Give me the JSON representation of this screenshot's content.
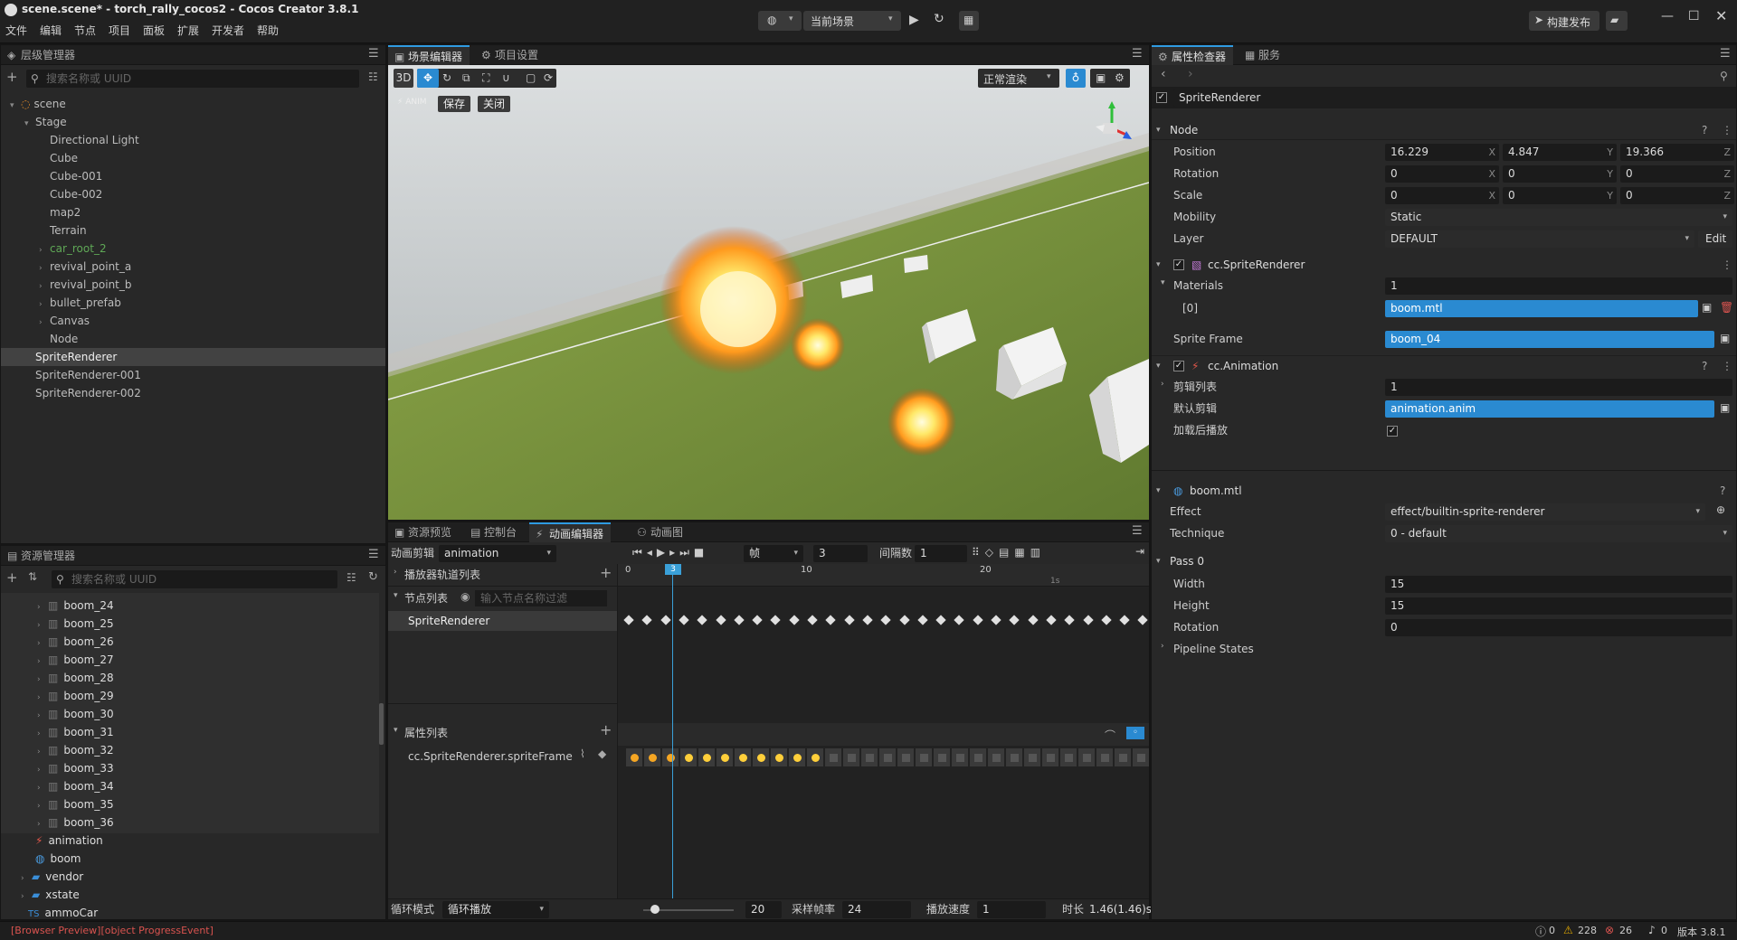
{
  "window": {
    "title": "scene.scene* - torch_rally_cocos2 - Cocos Creator 3.8.1"
  },
  "menu": [
    "文件",
    "编辑",
    "节点",
    "项目",
    "面板",
    "扩展",
    "开发者",
    "帮助"
  ],
  "toolbar": {
    "scene_select": "当前场景",
    "build_publish": "构建发布"
  },
  "hierarchy": {
    "tab": "层级管理器",
    "search_placeholder": "搜索名称或 UUID",
    "items": [
      {
        "label": "scene",
        "indent": 0,
        "arrow": "▾",
        "color": "#bcbcbc"
      },
      {
        "label": "Stage",
        "indent": 1,
        "arrow": "▾",
        "color": "#bcbcbc"
      },
      {
        "label": "Directional Light",
        "indent": 2,
        "arrow": "",
        "color": "#bcbcbc"
      },
      {
        "label": "Cube",
        "indent": 2,
        "arrow": "",
        "color": "#bcbcbc"
      },
      {
        "label": "Cube-001",
        "indent": 2,
        "arrow": "",
        "color": "#bcbcbc"
      },
      {
        "label": "Cube-002",
        "indent": 2,
        "arrow": "",
        "color": "#bcbcbc"
      },
      {
        "label": "map2",
        "indent": 2,
        "arrow": "",
        "color": "#bcbcbc"
      },
      {
        "label": "Terrain",
        "indent": 2,
        "arrow": "",
        "color": "#bcbcbc"
      },
      {
        "label": "car_root_2",
        "indent": 2,
        "arrow": "›",
        "color": "#5fa856"
      },
      {
        "label": "revival_point_a",
        "indent": 2,
        "arrow": "›",
        "color": "#bcbcbc"
      },
      {
        "label": "revival_point_b",
        "indent": 2,
        "arrow": "›",
        "color": "#bcbcbc"
      },
      {
        "label": "bullet_prefab",
        "indent": 2,
        "arrow": "›",
        "color": "#bcbcbc"
      },
      {
        "label": "Canvas",
        "indent": 2,
        "arrow": "›",
        "color": "#bcbcbc"
      },
      {
        "label": "Node",
        "indent": 2,
        "arrow": "",
        "color": "#bcbcbc"
      },
      {
        "label": "SpriteRenderer",
        "indent": 1,
        "arrow": "",
        "color": "#eeeeee",
        "selected": true
      },
      {
        "label": "SpriteRenderer-001",
        "indent": 1,
        "arrow": "",
        "color": "#bcbcbc"
      },
      {
        "label": "SpriteRenderer-002",
        "indent": 1,
        "arrow": "",
        "color": "#bcbcbc"
      }
    ]
  },
  "assets": {
    "tab": "资源管理器",
    "search_placeholder": "搜索名称或 UUID",
    "items": [
      "boom_24",
      "boom_25",
      "boom_26",
      "boom_27",
      "boom_28",
      "boom_29",
      "boom_30",
      "boom_31",
      "boom_32",
      "boom_33",
      "boom_34",
      "boom_35",
      "boom_36"
    ],
    "extra": [
      {
        "label": "animation",
        "icon": "anim"
      },
      {
        "label": "boom",
        "icon": "mtl"
      },
      {
        "label": "vendor",
        "icon": "folder"
      },
      {
        "label": "xstate",
        "icon": "folder"
      },
      {
        "label": "ammoCar",
        "icon": "ts"
      }
    ]
  },
  "scene": {
    "tabs": [
      "场景编辑器",
      "项目设置"
    ],
    "mode_3d": "3D",
    "render_mode": "正常渲染",
    "anim_label": "ANIM",
    "save": "保存",
    "close": "关闭"
  },
  "anim": {
    "tabs": [
      "资源预览",
      "控制台",
      "动画编辑器",
      "动画图"
    ],
    "clip_label": "动画剪辑",
    "clip_value": "animation",
    "unit": "帧",
    "frame": "3",
    "interval_label": "间隔数",
    "interval": "1",
    "player_tracks": "播放器轨道列表",
    "node_list": "节点列表",
    "node_filter": "输入节点名称过滤",
    "node_item": "SpriteRenderer",
    "prop_list": "属性列表",
    "prop_item": "cc.SpriteRenderer.spriteFrame",
    "ruler": [
      "0",
      "3",
      "10",
      "20",
      "1s"
    ],
    "loop_label": "循环模式",
    "loop_value": "循环播放",
    "slider_value": "20",
    "sample_label": "采样帧率",
    "sample": "24",
    "speed_label": "播放速度",
    "speed": "1",
    "duration_label": "时长",
    "duration": "1.46(1.46)s"
  },
  "inspector": {
    "tabs": [
      "属性检查器",
      "服务"
    ],
    "node_name": "SpriteRenderer",
    "node_section": "Node",
    "position": {
      "label": "Position",
      "x": "16.229",
      "y": "4.847",
      "z": "19.366"
    },
    "rotation": {
      "label": "Rotation",
      "x": "0",
      "y": "0",
      "z": "0"
    },
    "scale": {
      "label": "Scale",
      "x": "0",
      "y": "0",
      "z": "0"
    },
    "mobility": {
      "label": "Mobility",
      "value": "Static"
    },
    "layer": {
      "label": "Layer",
      "value": "DEFAULT",
      "edit": "Edit"
    },
    "sprite_renderer": "cc.SpriteRenderer",
    "materials": {
      "label": "Materials",
      "count": "1",
      "index": "[0]",
      "value": "boom.mtl"
    },
    "sprite_frame": {
      "label": "Sprite Frame",
      "value": "boom_04"
    },
    "animation": "cc.Animation",
    "clips": {
      "label": "剪辑列表",
      "value": "1"
    },
    "default_clip": {
      "label": "默认剪辑",
      "value": "animation.anim"
    },
    "play_on_load": {
      "label": "加载后播放"
    },
    "mtl": "boom.mtl",
    "effect": {
      "label": "Effect",
      "value": "effect/builtin-sprite-renderer"
    },
    "technique": {
      "label": "Technique",
      "value": "0 - default"
    },
    "pass": "Pass 0",
    "width": {
      "label": "Width",
      "value": "15"
    },
    "height": {
      "label": "Height",
      "value": "15"
    },
    "prot": {
      "label": "Rotation",
      "value": "0"
    },
    "pipeline": "Pipeline States"
  },
  "status": {
    "message": "[Browser Preview][object ProgressEvent]",
    "info": "0",
    "warn": "228",
    "err": "26",
    "notify": "0",
    "version": "版本 3.8.1"
  },
  "colors": {
    "accent": "#2f9be2",
    "error": "#d9534f",
    "warn": "#e0a800"
  }
}
